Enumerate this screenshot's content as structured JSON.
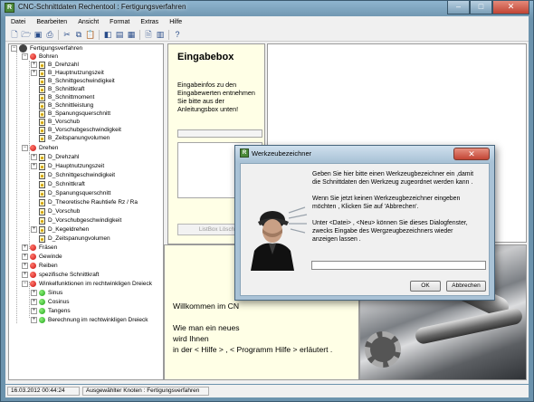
{
  "window": {
    "title": "CNC-Schnittdaten Rechentool : Fertigungsverfahren",
    "icon": "app-icon"
  },
  "menu": [
    "Datei",
    "Bearbeiten",
    "Ansicht",
    "Format",
    "Extras",
    "Hilfe"
  ],
  "tree": {
    "root": "Fertigungsverfahren",
    "bohren": {
      "label": "Bohren",
      "items": [
        "B_Drehzahl",
        "B_Hauptnutzungszeit",
        "B_Schnittgeschwindigkeit",
        "B_Schnittkraft",
        "B_Schnittmoment",
        "B_Schnittleistung",
        "B_Spanungsquerschnitt",
        "B_Vorschub",
        "B_Vorschubgeschwindigkeit",
        "B_Zeitspanungvolumen"
      ]
    },
    "drehen": {
      "label": "Drehen",
      "items": [
        "D_Drehzahl",
        "D_Hauptnutzungszeit",
        "D_Schnittgeschwindigkeit",
        "D_Schnittkraft",
        "D_Spanungsquerschnitt",
        "D_Theoretische Rauhtiefe Rz / Ra",
        "D_Vorschub",
        "D_Vorschubgeschwindigkeit",
        "D_Kegeldrehen",
        "D_Zeitspanungvolumen"
      ]
    },
    "others": [
      "Fräsen",
      "Gewinde",
      "Reiben",
      "spezifische Schnittkraft"
    ],
    "winkel": {
      "label": "Winkelfunktionen im rechtwinkligen Dreieck",
      "items": [
        "Sinus",
        "Cosinus",
        "Tangens",
        "Berechnung im rechtwinkligen Dreieck"
      ]
    }
  },
  "eingabebox": {
    "title": "Eingabebox",
    "info": "Eingabeinfos zu den Eingabewerten entnehmen Sie bitte aus der Anleitungsbox unten!",
    "listbox_button": "ListBox Löschen"
  },
  "welcome": {
    "line1": "Willkommen im CN",
    "line2": "Wie man ein neues",
    "line3": "wird Ihnen",
    "line4": "in der < Hilfe > , < Programm Hilfe > erläutert ."
  },
  "status": {
    "datetime": "16.03.2012 00:44:24",
    "node": "Ausgewählter Knoten : Fertigungsverfahren"
  },
  "dialog": {
    "title": "Werkzeubezeichner",
    "text1a": "Geben Sie hier bitte einen Werkzeugbezeichner ein ,damit",
    "text1b": "die Schnittdaten den Werkzeug zugeordnet werden kann .",
    "text2a": "Wenn Sie jetzt keinen Werkzeugbezeichner eingeben",
    "text2b": "möchten , Klicken Sie auf 'Abbrechen'.",
    "text3a": "Unter <Datei> , <Neu> können Sie dieses Dialogfenster,",
    "text3b": "zwecks Eingabe des Wergzeugbezeichners wieder",
    "text3c": "anzeigen lassen .",
    "input_value": "",
    "ok": "OK",
    "cancel": "Abbrechen"
  }
}
